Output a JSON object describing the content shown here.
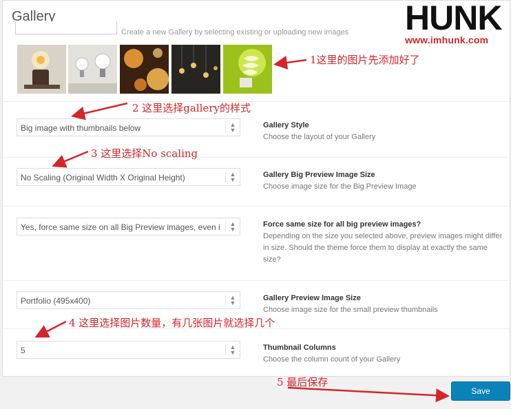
{
  "dialog": {
    "title": "Gallery"
  },
  "logo": {
    "brand": "HUNK",
    "url": "www.imhunk.com"
  },
  "hint": "Create a new Gallery by selecting existing or uploading new images",
  "thumbnails": [
    "lamp-warm",
    "bulbs-white",
    "bulbs-orange",
    "bulbs-hanging",
    "bulb-green"
  ],
  "settings": [
    {
      "value": "Big image with thumbnails below",
      "label": "Gallery Style",
      "desc": "Choose the layout of your Gallery"
    },
    {
      "value": "No Scaling (Original Width X Original Height)",
      "label": "Gallery Big Preview Image Size",
      "desc": "Choose image size for the Big Preview Image"
    },
    {
      "value": "Yes, force same size on all Big Preview images, even if",
      "label": "Force same size for all big preview images?",
      "desc": "Depending on the size you selected above, preview images might differ in size. Should the theme force them to display at exactly the same size?"
    },
    {
      "value": "Portfolio (495x400)",
      "label": "Gallery Preview Image Size",
      "desc": "Choose image size for the small preview thumbnails"
    },
    {
      "value": "5",
      "label": "Thumbnail Columns",
      "desc": "Choose the column count of your Gallery"
    }
  ],
  "save_label": "Save",
  "annotations": {
    "a1": "1这里的图片先添加好了",
    "a2": "2  这里选择gallery的样式",
    "a3": "3  这里选择No scaling",
    "a4": "4  这里选择图片数量，有几张图片就选择几个",
    "a5": "5         最后保存"
  },
  "colors": {
    "accent": "#0a83b8",
    "annotation": "#d4252a"
  }
}
